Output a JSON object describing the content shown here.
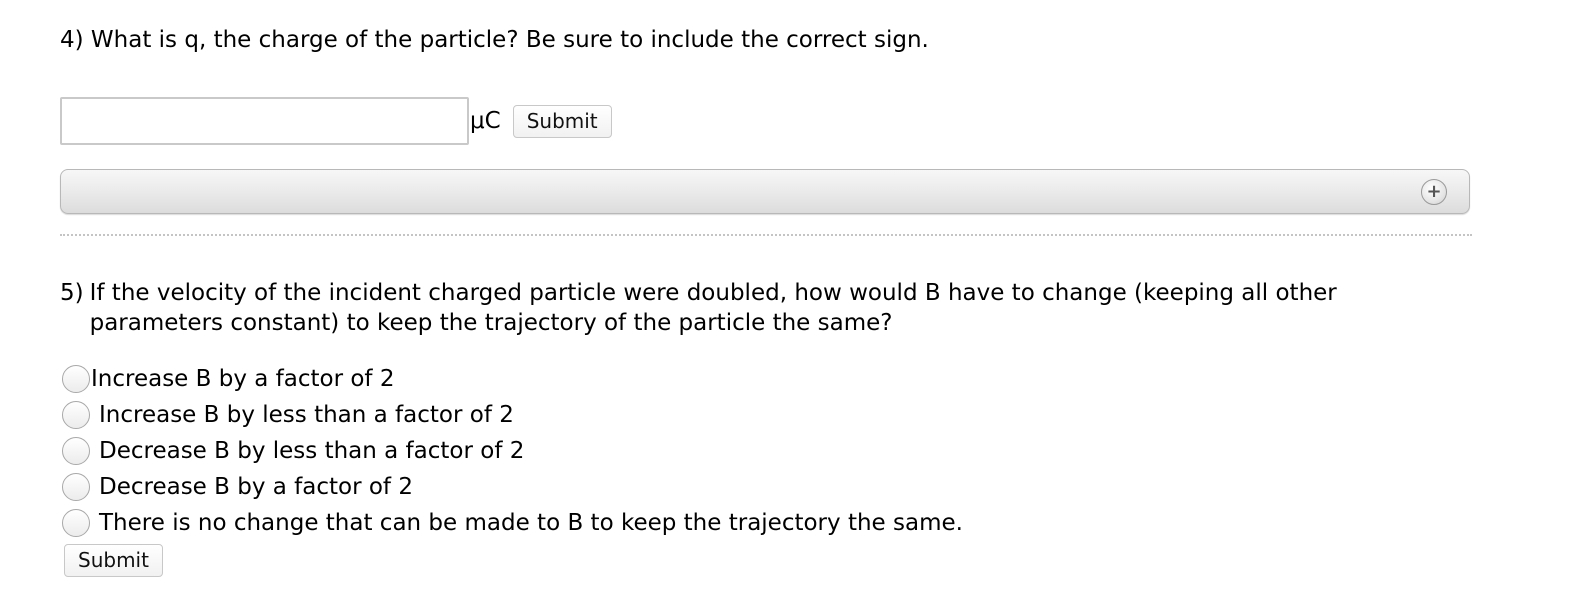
{
  "question4": {
    "prompt": "4) What is q, the charge of the particle? Be sure to include the correct sign.",
    "answer_value": "",
    "unit": "μC",
    "submit_label": "Submit"
  },
  "hint": {
    "icon": "plus-circle-icon"
  },
  "question5": {
    "number": "5)",
    "prompt": "If the velocity of the incident charged particle were doubled, how would B have to change (keeping all other parameters constant) to keep the trajectory of the particle the same?",
    "options": [
      "Increase B by a factor of 2",
      "Increase B by less than a factor of 2",
      "Decrease B by less than a factor of 2",
      "Decrease B by a factor of 2",
      "There is no change that can be made to B to keep the trajectory the same."
    ],
    "submit_label": "Submit"
  }
}
